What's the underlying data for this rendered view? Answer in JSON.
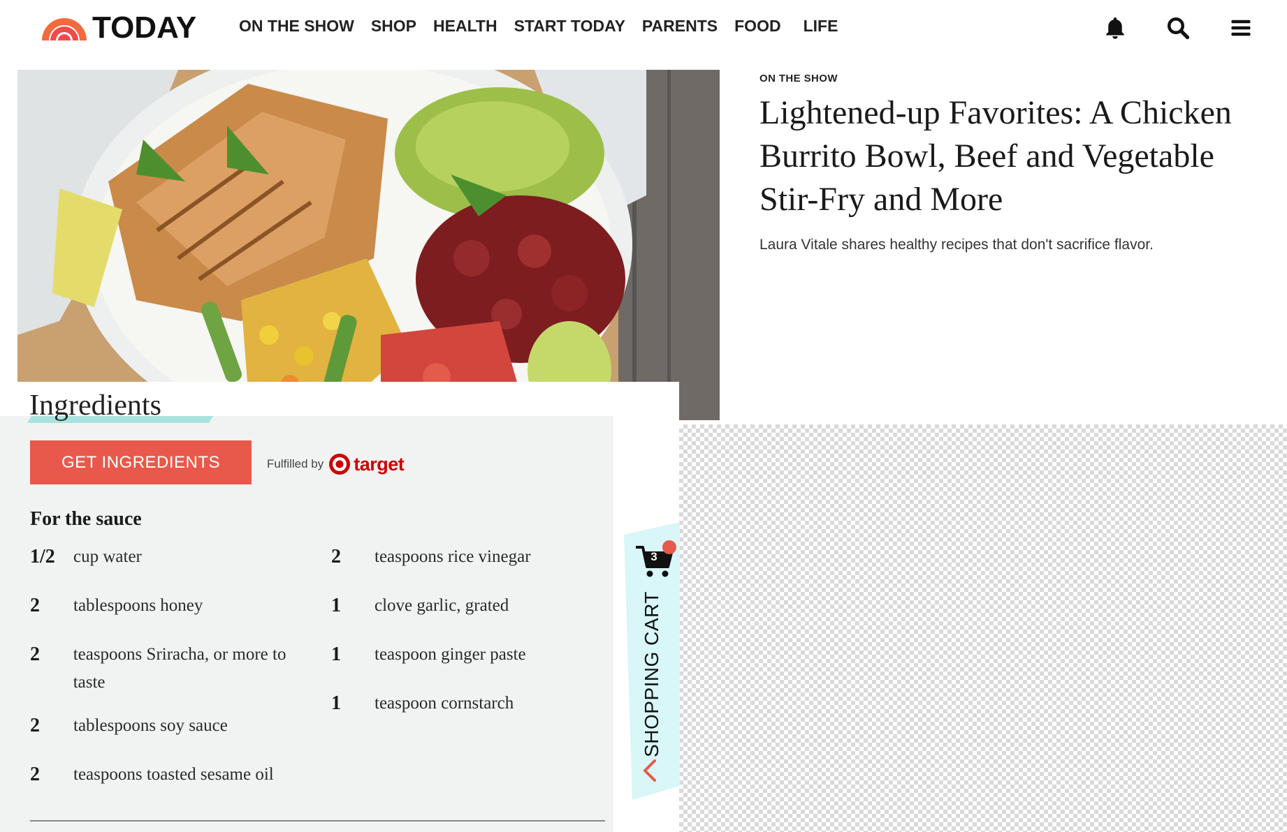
{
  "header": {
    "logo_text": "TODAY",
    "nav": [
      "ON THE SHOW",
      "SHOP",
      "HEALTH",
      "START TODAY",
      "PARENTS",
      "FOOD",
      "LIFE"
    ],
    "icons": [
      "bell-icon",
      "search-icon",
      "menu-icon"
    ]
  },
  "article": {
    "kicker": "ON THE SHOW",
    "headline": "Lightened-up Favorites: A Chicken Burrito Bowl, Beef and Vegetable Stir-Fry and More",
    "dek": "Laura Vitale shares healthy recipes that don't sacrifice flavor."
  },
  "ingredients": {
    "title": "Ingredients",
    "button_label": "GET INGREDIENTS",
    "fulfilled_label": "Fulfilled by",
    "fulfiller": "target",
    "section_title": "For the sauce",
    "left": [
      {
        "qty": "1/2",
        "desc": "cup water"
      },
      {
        "qty": "2",
        "desc": "tablespoons honey"
      },
      {
        "qty": "2",
        "desc": "teaspoons Sriracha, or more to taste"
      },
      {
        "qty": "2",
        "desc": "tablespoons soy sauce"
      },
      {
        "qty": "2",
        "desc": "teaspoons toasted sesame oil"
      }
    ],
    "right": [
      {
        "qty": "2",
        "desc": "teaspoons rice vinegar"
      },
      {
        "qty": "1",
        "desc": "clove garlic, grated"
      },
      {
        "qty": "1",
        "desc": "teaspoon ginger paste"
      },
      {
        "qty": "1",
        "desc": "teaspoon cornstarch"
      }
    ]
  },
  "cart": {
    "label": "SHOPPING CART",
    "count": "3"
  },
  "colors": {
    "accent": "#e8594b",
    "target_red": "#cc0000",
    "underline_teal": "#a9e3e0",
    "cart_tab_bg": "#d9f6f8"
  }
}
